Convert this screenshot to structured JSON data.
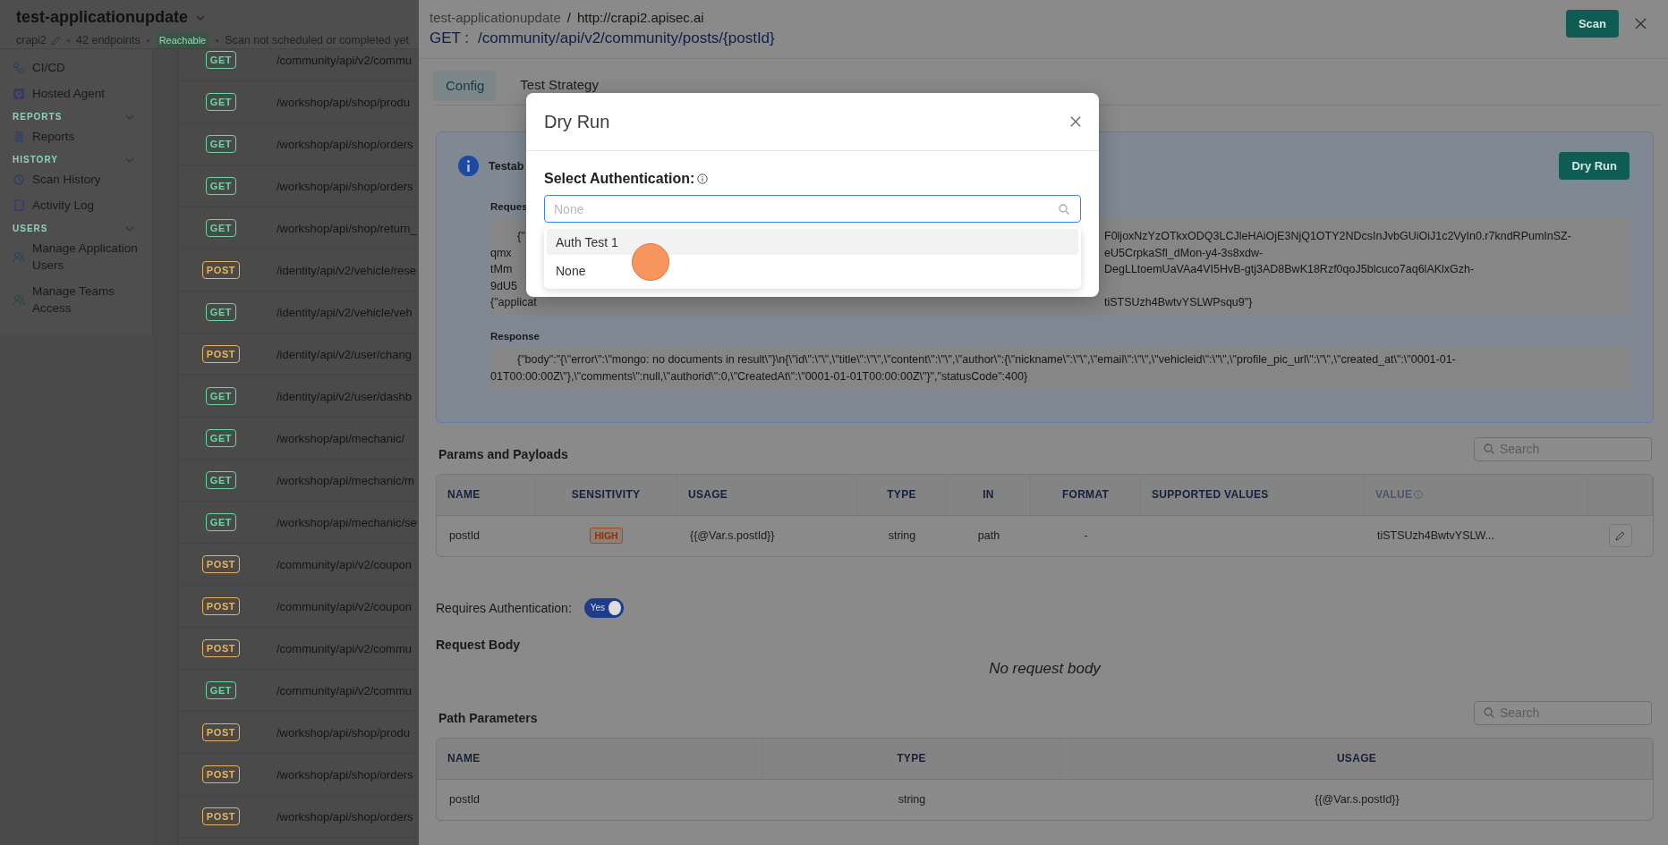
{
  "app": {
    "title": "test-applicationupdate",
    "project": "crapi2",
    "endpoint_count": "42 endpoints",
    "reachability": "Reachable",
    "scan_status": "Scan not scheduled or completed yet"
  },
  "sidebar": {
    "items": [
      {
        "kind": "link",
        "label": "CI/CD"
      },
      {
        "kind": "link",
        "label": "Hosted Agent"
      },
      {
        "kind": "section",
        "label": "REPORTS",
        "expanded": true
      },
      {
        "kind": "link",
        "label": "Reports"
      },
      {
        "kind": "section",
        "label": "HISTORY",
        "expanded": true
      },
      {
        "kind": "link",
        "label": "Scan History"
      },
      {
        "kind": "link",
        "label": "Activity Log"
      },
      {
        "kind": "section",
        "label": "USERS",
        "expanded": true
      },
      {
        "kind": "link",
        "label": "Manage Application Users"
      },
      {
        "kind": "link",
        "label": "Manage Teams Access"
      }
    ]
  },
  "endpoints": [
    {
      "method": "GET",
      "color": "#6fd3a3",
      "path": "/community/api/v2/commu"
    },
    {
      "method": "GET",
      "color": "#6fd3a3",
      "path": "/workshop/api/shop/produ"
    },
    {
      "method": "GET",
      "color": "#6fd3a3",
      "path": "/workshop/api/shop/orders"
    },
    {
      "method": "GET",
      "color": "#6fd3a3",
      "path": "/workshop/api/shop/orders"
    },
    {
      "method": "GET",
      "color": "#6fd3a3",
      "path": "/workshop/api/shop/return_"
    },
    {
      "method": "POST",
      "color": "#e3b46a",
      "path": "/identity/api/v2/vehicle/rese"
    },
    {
      "method": "GET",
      "color": "#6fd3a3",
      "path": "/identity/api/v2/vehicle/veh"
    },
    {
      "method": "POST",
      "color": "#e3b46a",
      "path": "/identity/api/v2/user/chang"
    },
    {
      "method": "GET",
      "color": "#6fd3a3",
      "path": "/identity/api/v2/user/dashb"
    },
    {
      "method": "GET",
      "color": "#6fd3a3",
      "path": "/workshop/api/mechanic/"
    },
    {
      "method": "GET",
      "color": "#6fd3a3",
      "path": "/workshop/api/mechanic/m"
    },
    {
      "method": "GET",
      "color": "#6fd3a3",
      "path": "/workshop/api/mechanic/se"
    },
    {
      "method": "POST",
      "color": "#e3b46a",
      "path": "/community/api/v2/coupon"
    },
    {
      "method": "POST",
      "color": "#e3b46a",
      "path": "/community/api/v2/coupon"
    },
    {
      "method": "POST",
      "color": "#e3b46a",
      "path": "/community/api/v2/commu"
    },
    {
      "method": "GET",
      "color": "#6fd3a3",
      "path": "/community/api/v2/commu"
    },
    {
      "method": "POST",
      "color": "#e3b46a",
      "path": "/workshop/api/shop/produ"
    },
    {
      "method": "POST",
      "color": "#e3b46a",
      "path": "/workshop/api/shop/orders"
    },
    {
      "method": "POST",
      "color": "#e3b46a",
      "path": "/workshop/api/shop/orders"
    }
  ],
  "drawer": {
    "breadcrumb": {
      "application": "test-applicationupdate",
      "separator": "/",
      "host": "http://crapi2.apisec.ai"
    },
    "method": "GET :",
    "path": "/community/api/v2/community/posts/{postId}",
    "scan_button": "Scan",
    "tabs": [
      {
        "label": "Config",
        "selected": true
      },
      {
        "label": "Test Strategy",
        "selected": false
      }
    ],
    "test_card": {
      "title": "Testab",
      "dry_run_button": "Dry Run",
      "request_label": "Reques",
      "request_lines": [
        {
          "left": "{\"",
          "right": "F0ljoxNzYzOTkxODQ3LCJleHAiOjE3NjQ1OTY2NDcsInJvbGUiOiJ1c2VyIn0.r7kndRPumInSZ-"
        },
        {
          "left": "qmx",
          "right": "eU5CrpkaSfl_dMon-y4-3s8xdw-"
        },
        {
          "left": "tMm",
          "right": "DegLLtoemUaVAa4VI5HvB-gtj3AD8BwK18Rzf0qoJ5blcuco7aq6lAKlxGzh-"
        },
        {
          "left": "9dU5"
        },
        {
          "left": "{\"applicat",
          "right": "tiSTSUzh4BwtvYSLWPsqu9\"}"
        }
      ],
      "response_label": "Response",
      "response": "{\"body\":\"{\\\"error\\\":\\\"mongo: no documents in result\\\"}\\n{\\\"id\\\":\\\"\\\",\\\"title\\\":\\\"\\\",\\\"content\\\":\\\"\\\",\\\"author\\\":{\\\"nickname\\\":\\\"\\\",\\\"email\\\":\\\"\\\",\\\"vehicleid\\\":\\\"\\\",\\\"profile_pic_url\\\":\\\"\\\",\\\"created_at\\\":\\\"0001-01-01T00:00:00Z\\\"},\\\"comments\\\":null,\\\"authorid\\\":0,\\\"CreatedAt\\\":\\\"0001-01-01T00:00:00Z\\\"}\",\"statusCode\":400}"
    },
    "params": {
      "title": "Params and Payloads",
      "search_placeholder": "Search",
      "columns": [
        {
          "label": "NAME",
          "muted": false,
          "hint": false
        },
        {
          "label": "SENSITIVITY",
          "muted": false,
          "hint": false
        },
        {
          "label": "USAGE",
          "muted": false,
          "hint": false
        },
        {
          "label": "TYPE",
          "muted": false,
          "hint": false
        },
        {
          "label": "IN",
          "muted": false,
          "hint": false
        },
        {
          "label": "FORMAT",
          "muted": false,
          "hint": false
        },
        {
          "label": "SUPPORTED VALUES",
          "muted": false,
          "hint": false
        },
        {
          "label": "VALUE",
          "muted": true,
          "hint": true
        }
      ],
      "rows": [
        {
          "name": "postId",
          "sensitivity": "HIGH",
          "usage": "{{@Var.s.postId}}",
          "type": "string",
          "in": "path",
          "format": "-",
          "value": "tiSTSUzh4BwtvYSLW..."
        }
      ]
    },
    "requires_auth": {
      "label": "Requires Authentication:",
      "toggle_text": "Yes",
      "on": true
    },
    "request_body": {
      "title": "Request Body",
      "empty_text": "No request body"
    },
    "path_parameters": {
      "title": "Path Parameters",
      "search_placeholder": "Search",
      "columns": [
        "NAME",
        "TYPE",
        "USAGE"
      ],
      "rows": [
        {
          "name": "postId",
          "type": "string",
          "usage": "{{@Var.s.postId}}"
        }
      ]
    }
  },
  "modal": {
    "title": "Dry Run",
    "field_label": "Select Authentication:",
    "placeholder": "None",
    "options": [
      {
        "label": "Auth Test 1",
        "highlighted": true
      },
      {
        "label": "None",
        "highlighted": false
      }
    ]
  }
}
